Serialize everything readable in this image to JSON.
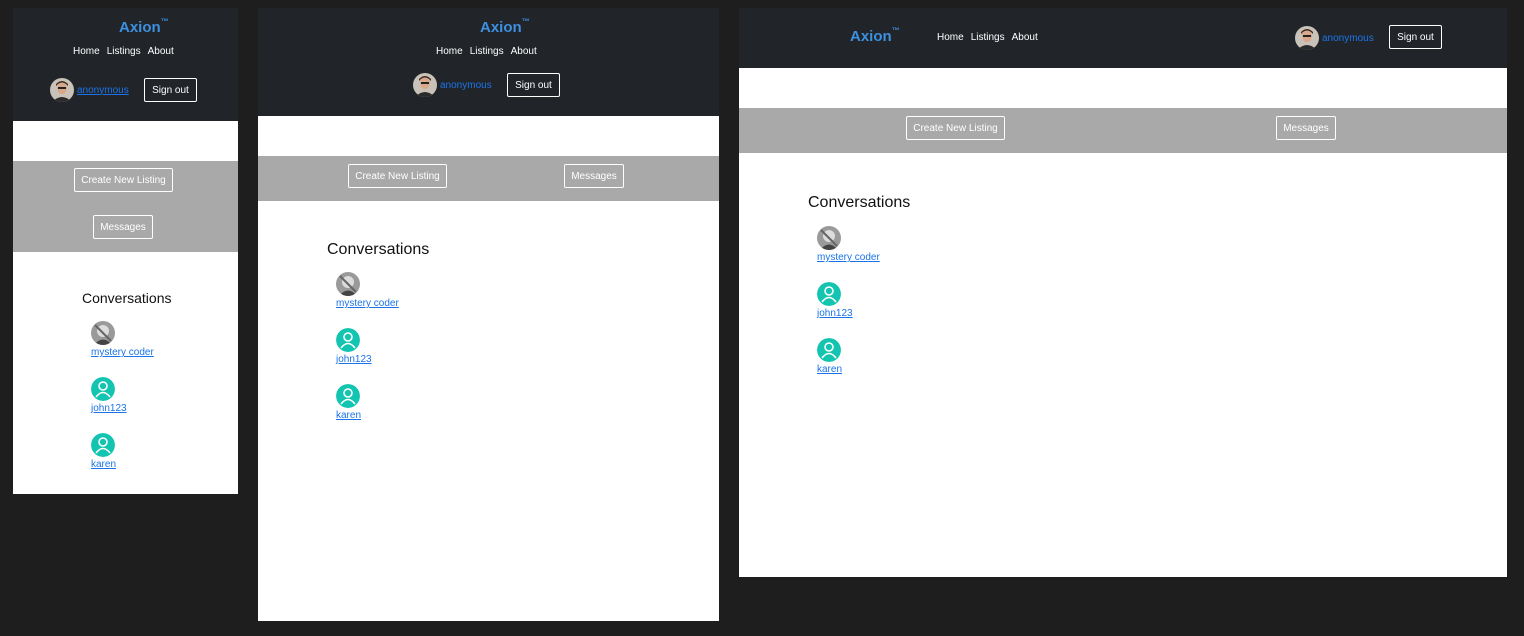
{
  "brand": {
    "name": "Axion",
    "tm": "™"
  },
  "nav_links": [
    "Home",
    "Listings",
    "About"
  ],
  "user": {
    "name": "anonymous"
  },
  "signout_label": "Sign out",
  "actions": {
    "create_listing": "Create New Listing",
    "messages": "Messages"
  },
  "conversations_title": "Conversations",
  "conversations": [
    {
      "name": "mystery coder",
      "avatar": "photo"
    },
    {
      "name": "john123",
      "avatar": "default-user-icon"
    },
    {
      "name": "karen",
      "avatar": "default-user-icon"
    }
  ],
  "colors": {
    "page_bg": "#1e1e1e",
    "navbar": "#212529",
    "brand": "#3d8fe0",
    "link": "#1a73e8",
    "action_band": "#a9a9a9",
    "user_icon": "#13c4b0"
  }
}
